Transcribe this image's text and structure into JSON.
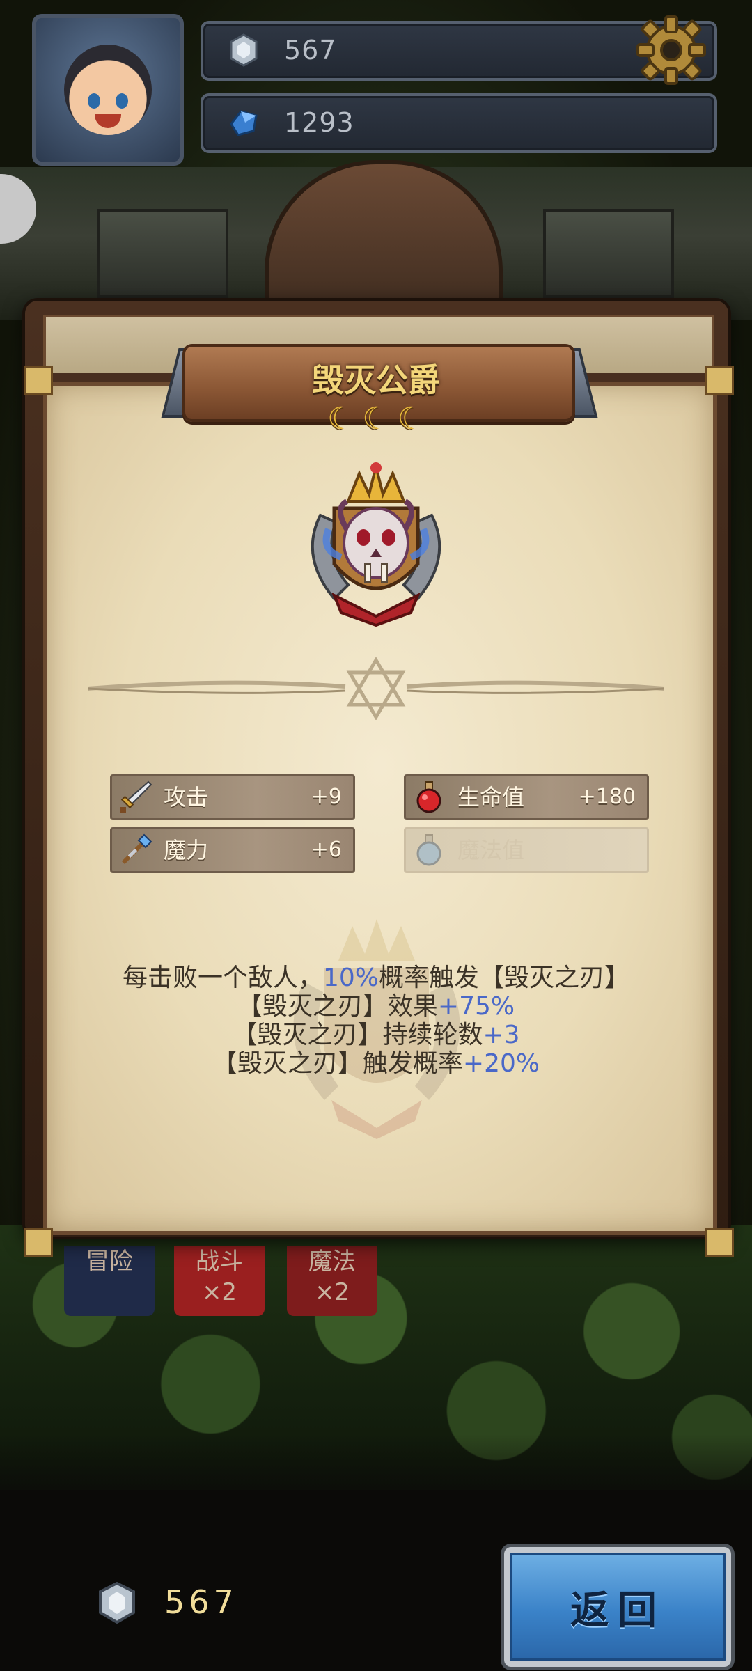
{
  "hud": {
    "silver_icon": "silver-gem-icon",
    "silver_value": "567",
    "gem_icon": "blue-crystal-icon",
    "gem_value": "1293",
    "settings_icon": "gear-icon"
  },
  "background_tabs": [
    {
      "label": "冒险"
    },
    {
      "label": "战斗",
      "badge": "×2"
    },
    {
      "label": "魔法",
      "badge": "×2"
    }
  ],
  "panel": {
    "title": "毁灭公爵",
    "rank_moons": 3,
    "rank_icon": "crescent-moon-icon",
    "emblem_icon": "demon-skull-crown-emblem",
    "stats": [
      {
        "icon": "sword-icon",
        "label": "攻击",
        "value": "+9",
        "enabled": true
      },
      {
        "icon": "health-potion-icon",
        "label": "生命值",
        "value": "+180",
        "enabled": true
      },
      {
        "icon": "magic-staff-icon",
        "label": "魔力",
        "value": "+6",
        "enabled": true
      },
      {
        "icon": "mana-potion-icon",
        "label": "魔法值",
        "value": "",
        "enabled": false
      }
    ],
    "description": [
      {
        "parts": [
          {
            "t": "每击败一个敌人，"
          },
          {
            "t": "10%",
            "hl": true
          },
          {
            "t": "概率触发【毁灭之刃】"
          }
        ]
      },
      {
        "parts": [
          {
            "t": "【毁灭之刃】效果"
          },
          {
            "t": "+75%",
            "hl": true
          }
        ]
      },
      {
        "parts": [
          {
            "t": "【毁灭之刃】持续轮数"
          },
          {
            "t": "+3",
            "hl": true
          }
        ]
      },
      {
        "parts": [
          {
            "t": "【毁灭之刃】触发概率"
          },
          {
            "t": "+20%",
            "hl": true
          }
        ]
      }
    ]
  },
  "footer": {
    "coin_icon": "silver-gem-icon",
    "coin_value": "567",
    "back_label": "返回"
  },
  "colors": {
    "title_gold": "#f3d67a",
    "highlight_blue": "#4a68c8",
    "back_button_blue": "#3a82c8"
  }
}
